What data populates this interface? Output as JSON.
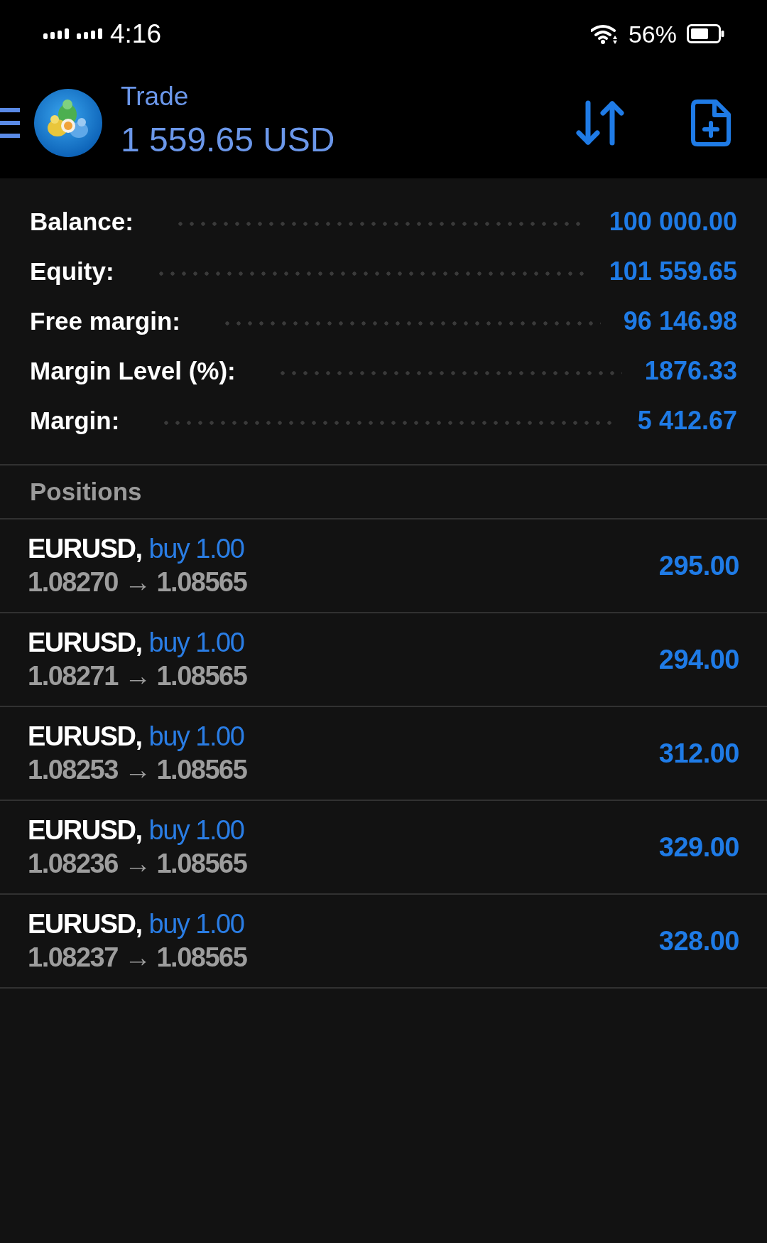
{
  "status_bar": {
    "time": "4:16",
    "battery": "56%"
  },
  "header": {
    "title": "Trade",
    "amount": "1 559.65 USD"
  },
  "account": [
    {
      "label": "Balance:",
      "value": "100 000.00"
    },
    {
      "label": "Equity:",
      "value": "101 559.65"
    },
    {
      "label": "Free margin:",
      "value": "96 146.98"
    },
    {
      "label": "Margin Level (%):",
      "value": "1876.33"
    },
    {
      "label": "Margin:",
      "value": "5 412.67"
    }
  ],
  "positions": {
    "title": "Positions",
    "items": [
      {
        "symbol": "EURUSD,",
        "order": "buy 1.00",
        "prices": "1.08270 → 1.08565",
        "profit": "295.00"
      },
      {
        "symbol": "EURUSD,",
        "order": "buy 1.00",
        "prices": "1.08271 → 1.08565",
        "profit": "294.00"
      },
      {
        "symbol": "EURUSD,",
        "order": "buy 1.00",
        "prices": "1.08253 → 1.08565",
        "profit": "312.00"
      },
      {
        "symbol": "EURUSD,",
        "order": "buy 1.00",
        "prices": "1.08236 → 1.08565",
        "profit": "329.00"
      },
      {
        "symbol": "EURUSD,",
        "order": "buy 1.00",
        "prices": "1.08237 → 1.08565",
        "profit": "328.00"
      }
    ]
  }
}
